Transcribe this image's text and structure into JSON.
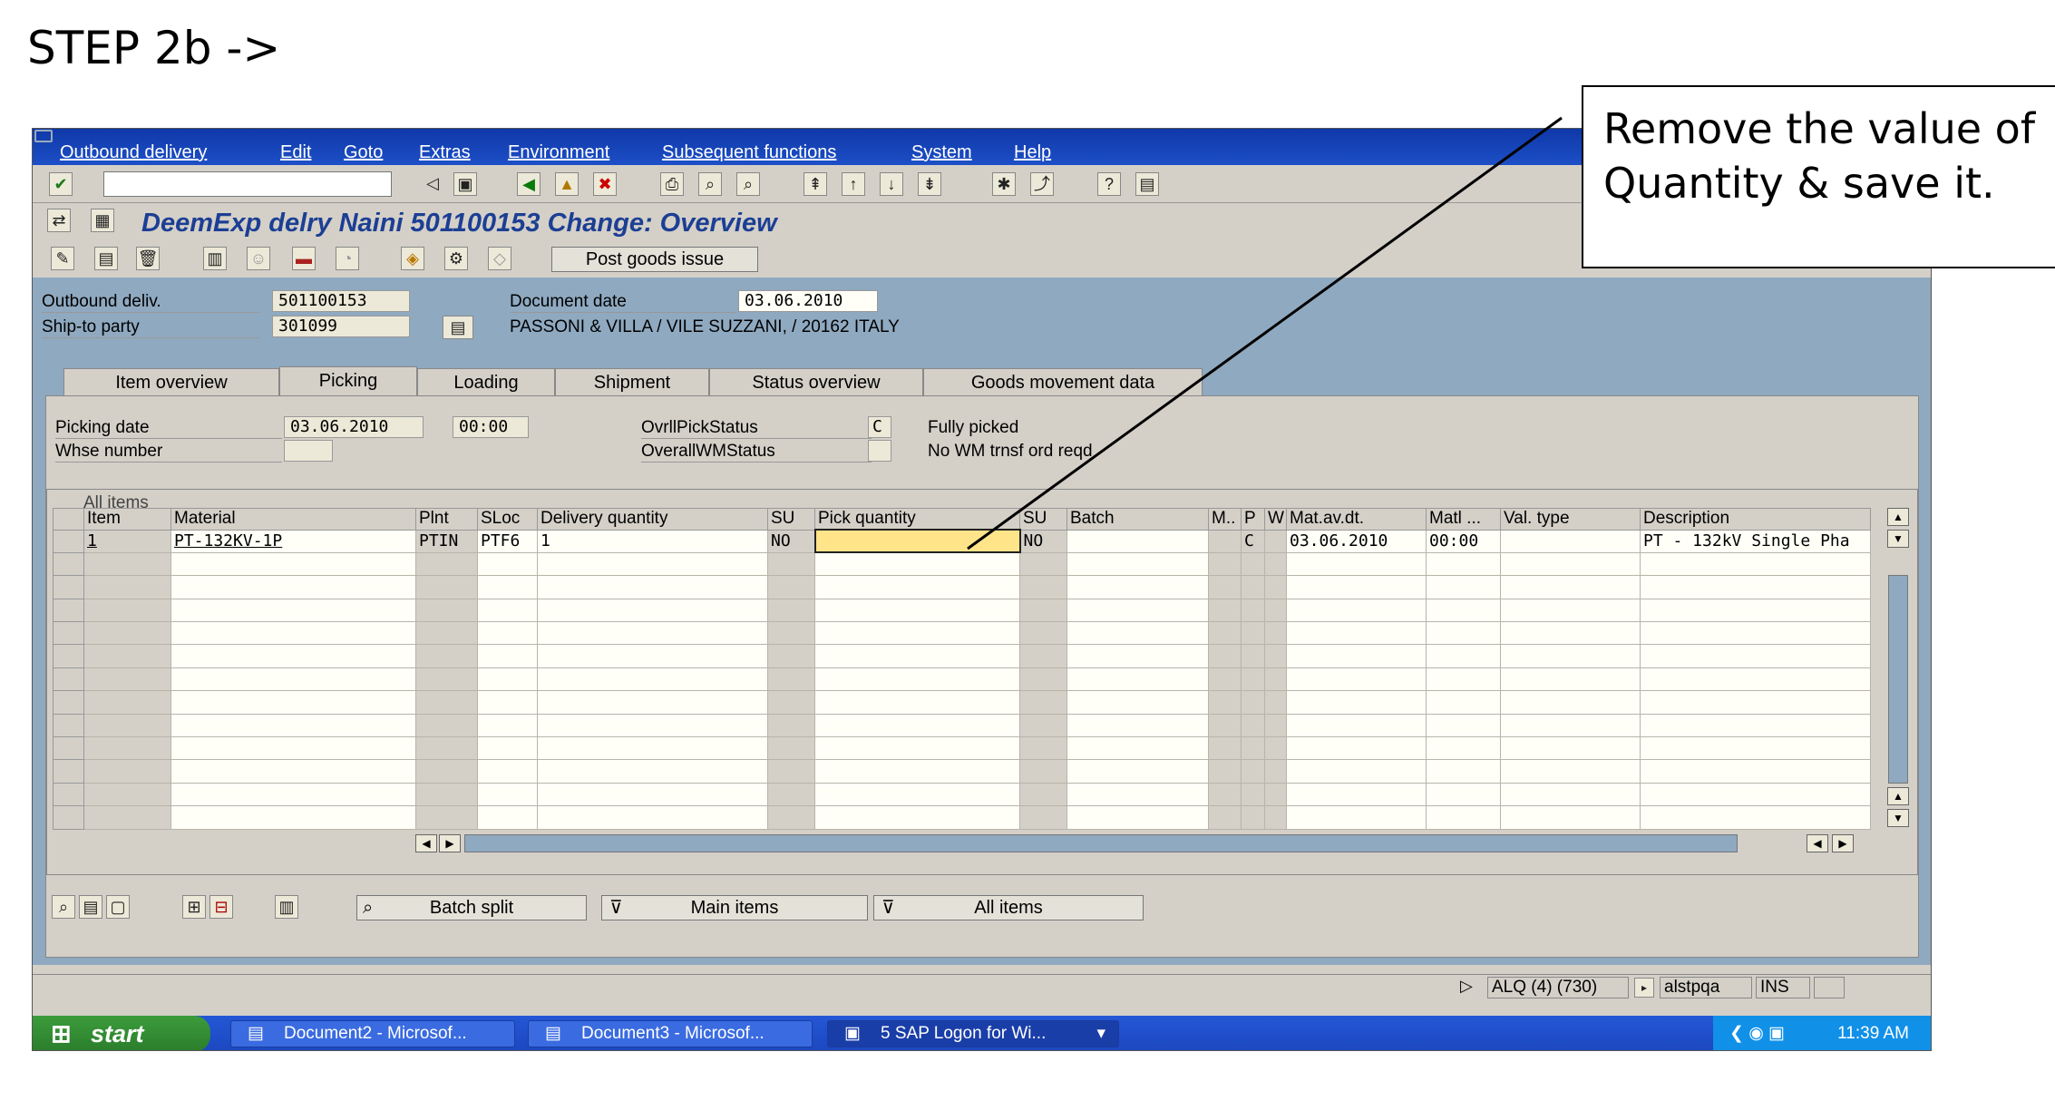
{
  "slide_title": "STEP 2b ->",
  "callout_text": "Remove the value of Quantity & save it.",
  "menu": [
    "Outbound delivery",
    "Edit",
    "Goto",
    "Extras",
    "Environment",
    "Subsequent functions",
    "System",
    "Help"
  ],
  "window_title": "DeemExp delry Naini 501100153 Change: Overview",
  "toolbar2": {
    "post_goods_issue": "Post goods issue"
  },
  "header": {
    "outbound_label": "Outbound deliv.",
    "outbound_value": "501100153",
    "document_date_label": "Document date",
    "document_date_value": "03.06.2010",
    "ship_to_label": "Ship-to party",
    "ship_to_value": "301099",
    "ship_to_address": "PASSONI & VILLA / VILE SUZZANI, / 20162 ITALY"
  },
  "tabs": [
    "Item overview",
    "Picking",
    "Loading",
    "Shipment",
    "Status overview",
    "Goods movement data"
  ],
  "active_tab": "Picking",
  "picking": {
    "picking_date_label": "Picking date",
    "picking_date_value": "03.06.2010",
    "picking_time_value": "00:00",
    "whse_label": "Whse number",
    "ovrl_label": "OvrllPickStatus",
    "ovrl_code": "C",
    "ovrl_text": "Fully picked",
    "wm_label": "OverallWMStatus",
    "wm_text": "No WM trnsf ord reqd"
  },
  "grid": {
    "title": "All items",
    "columns": [
      "Item",
      "Material",
      "Plnt",
      "SLoc",
      "Delivery quantity",
      "SU",
      "Pick quantity",
      "SU",
      "Batch",
      "M..",
      "P",
      "W",
      "Mat.av.dt.",
      "Matl ...",
      "Val. type",
      "Description"
    ],
    "row": {
      "item": "1",
      "material": "PT-132KV-1P",
      "plant": "PTIN",
      "sloc": "PTF6",
      "delivery_qty": "1",
      "su": "NO",
      "pick_qty": "",
      "su2": "NO",
      "batch": "",
      "p": "C",
      "mat_av_dt": "03.06.2010",
      "matl_time": "00:00",
      "val_type": "",
      "description": "PT - 132kV Single Pha"
    }
  },
  "bottom_buttons": {
    "batch_split": "Batch split",
    "main_items": "Main items",
    "all_items": "All items"
  },
  "status": {
    "system": "ALQ (4) (730)",
    "user": "alstpqa",
    "mode": "INS"
  },
  "taskbar": {
    "start": "start",
    "tasks": [
      "Document2 - Microsof...",
      "Document3 - Microsof...",
      "5 SAP Logon for Wi..."
    ],
    "clock": "11:39 AM"
  }
}
